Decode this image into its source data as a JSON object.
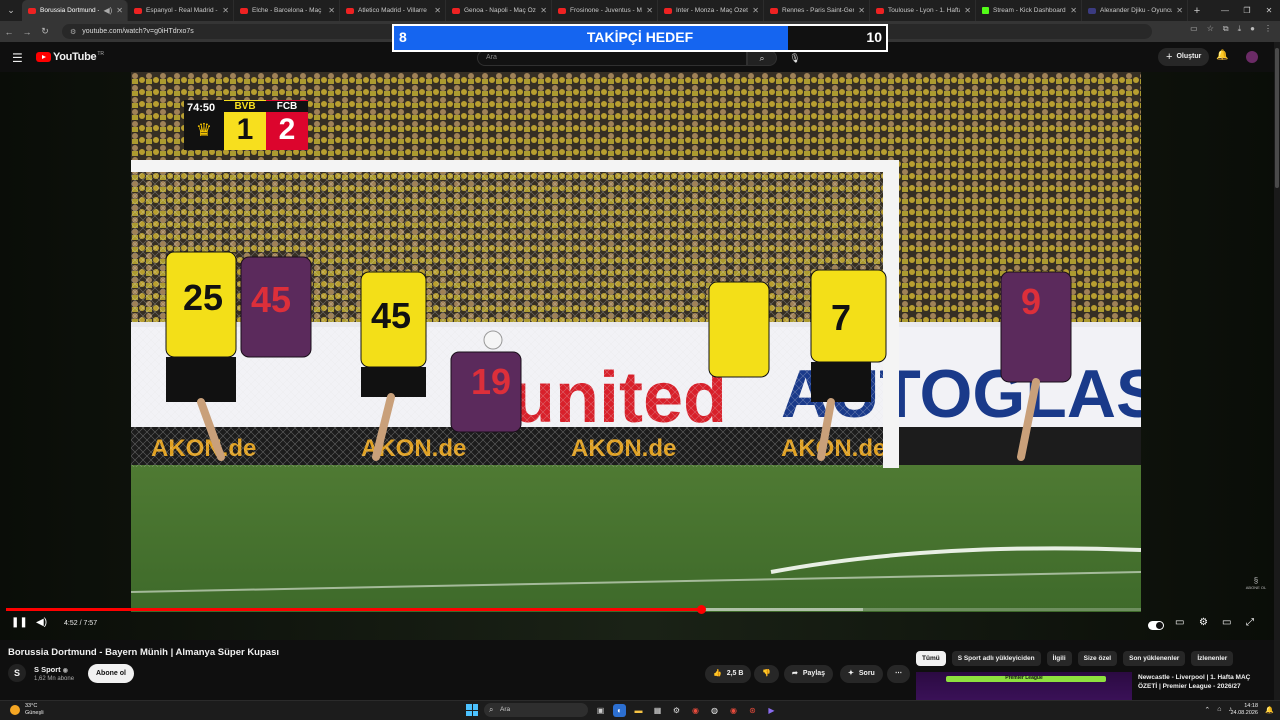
{
  "browser": {
    "tabs": [
      {
        "label": "Borussia Dortmund - B",
        "active": true,
        "icon": "youtube-icon"
      },
      {
        "label": "Espanyol - Real Madrid -",
        "icon": "youtube-icon"
      },
      {
        "label": "Elche - Barcelona - Maç",
        "icon": "youtube-icon"
      },
      {
        "label": "Atletico Madrid - Villarre",
        "icon": "youtube-icon"
      },
      {
        "label": "Genoa - Napoli - Maç Öz",
        "icon": "youtube-icon"
      },
      {
        "label": "Frosinone - Juventus - M",
        "icon": "youtube-icon"
      },
      {
        "label": "Inter - Monza - Maç Özet",
        "icon": "youtube-icon"
      },
      {
        "label": "Rennes - Paris Saint-Gerr",
        "icon": "youtube-icon"
      },
      {
        "label": "Toulouse - Lyon - 1. Hafta",
        "icon": "youtube-icon"
      },
      {
        "label": "Stream - Kick Dashboard",
        "icon": "kick-icon"
      },
      {
        "label": "Alexander Djiku - Oyuncu",
        "icon": "site-icon"
      }
    ],
    "url": "youtube.com/watch?v=g0iHTdrxo7s"
  },
  "youtube": {
    "logo_text": "YouTube",
    "region": "TR",
    "search_placeholder": "Ara",
    "create_label": "Oluştur"
  },
  "goal_overlay": {
    "current": "8",
    "title": "TAKİPÇİ HEDEF",
    "target": "10",
    "progress_fraction": 0.8
  },
  "scoreboard": {
    "clock": "74:50",
    "home_team": "BVB",
    "home_score": "1",
    "away_team": "FCB",
    "away_score": "2"
  },
  "player": {
    "time_display": "4:52 / 7:57",
    "played_fraction": 0.612,
    "buffered_fraction": 0.755,
    "watermark": "ABONE OL"
  },
  "video": {
    "title": "Borussia Dortmund - Bayern Münih | Almanya Süper Kupası",
    "channel_name": "S Sport",
    "channel_subs": "1,62 Mn abone",
    "subscribe_label": "Abone ol",
    "likes": "2,5 B",
    "share_label": "Paylaş",
    "ask_label": "Soru"
  },
  "recommendations": {
    "chips": [
      "Tümü",
      "S Sport adlı yükleyiciden",
      "İlgili",
      "Size özel",
      "Son yüklenenler",
      "İzlenenler"
    ],
    "first_title": "Newcastle - Liverpool | 1. Hafta MAÇ ÖZETİ | Premier League - 2026/27",
    "first_thumb_text": "Premier League"
  },
  "taskbar": {
    "temperature": "33°C",
    "weather": "Güneşli",
    "search_label": "Ara",
    "time": "14:18",
    "date": "24.08.2026"
  }
}
